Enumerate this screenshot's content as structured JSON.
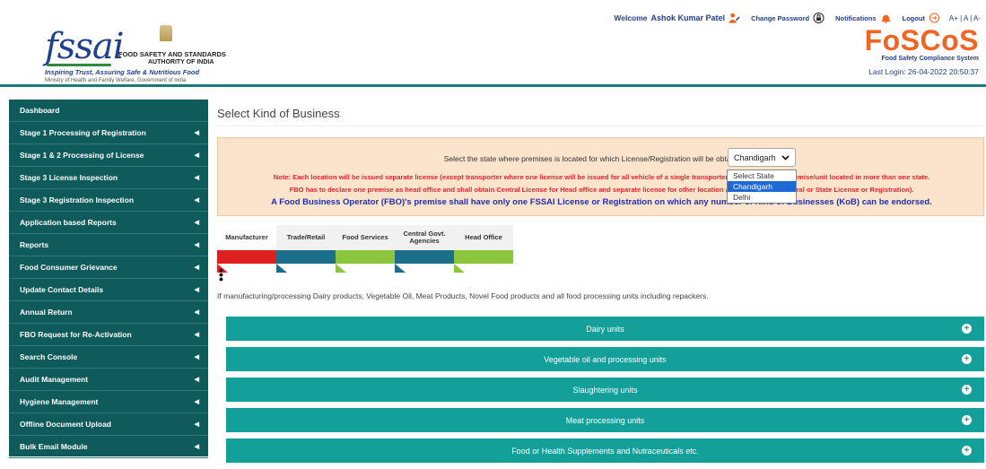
{
  "header": {
    "logo_word": "fssai",
    "org_line1": "FOOD SAFETY AND STANDARDS",
    "org_line2": "AUTHORITY OF INDIA",
    "tagline": "Inspiring Trust, Assuring Safe & Nutritious Food",
    "ministry": "Ministry of Health and Family Welfare, Government of India",
    "welcome": "Welcome",
    "user_name": "Ashok Kumar Patel",
    "change_password": "Change Password",
    "notifications": "Notifications",
    "logout": "Logout",
    "font_sizes": "A+ | A | A-",
    "brand_name": "FoSCoS",
    "brand_sub": "Food Safety Compliance System",
    "last_login": "Last Login: 26-04-2022 20:50:37"
  },
  "sidebar": {
    "items": [
      {
        "label": "Dashboard",
        "has_chevron": false
      },
      {
        "label": "Stage 1 Processing of Registration",
        "has_chevron": true
      },
      {
        "label": "Stage 1 & 2 Processing of License",
        "has_chevron": true
      },
      {
        "label": "Stage 3 License Inspection",
        "has_chevron": true
      },
      {
        "label": "Stage 3 Registration Inspection",
        "has_chevron": true
      },
      {
        "label": "Application based Reports",
        "has_chevron": true
      },
      {
        "label": "Reports",
        "has_chevron": true
      },
      {
        "label": "Food Consumer Grievance",
        "has_chevron": true
      },
      {
        "label": "Update Contact Details",
        "has_chevron": true
      },
      {
        "label": "Annual Return",
        "has_chevron": true
      },
      {
        "label": "FBO Request for Re-Activation",
        "has_chevron": true
      },
      {
        "label": "Search Console",
        "has_chevron": true
      },
      {
        "label": "Audit Management",
        "has_chevron": true
      },
      {
        "label": "Hygiene Management",
        "has_chevron": true
      },
      {
        "label": "Offline Document Upload",
        "has_chevron": true
      },
      {
        "label": "Bulk Email Module",
        "has_chevron": true
      }
    ]
  },
  "main": {
    "title": "Select Kind of Business",
    "state_prompt": "Select the state where premises is located for which License/Registration will be obtained.",
    "state_selected": "Chandigarh",
    "state_options": [
      "Select State",
      "Chandigarh",
      "Delhi"
    ],
    "note1": "Note: Each location will be issued separate license (except transporter where one license will be issued for all vehicle of a single transporter/ business having premise/unit located in more than one state.",
    "note2": "FBO has to declare one premise as head office and shall obtain Central License for Head office and separate license for other location as per eligibility (Central or State License or Registration).",
    "note3": "A Food Business Operator (FBO)'s premise shall have only one FSSAI License or Registration on which any number of Kind of Businesses (KoB) can be endorsed.",
    "tabs": [
      {
        "label": "Manufacturer",
        "color": "#e02020"
      },
      {
        "label": "Trade/Retail",
        "color": "#1c6f8a"
      },
      {
        "label": "Food Services",
        "color": "#8cc63f"
      },
      {
        "label": "Central Govt. Agencies",
        "color": "#1c6f8a"
      },
      {
        "label": "Head Office",
        "color": "#8cc63f"
      }
    ],
    "intro": "If manufacturing/processing Dairy products, Vegetable Oil, Meat Products, Novel Food products and all food processing units including repackers.",
    "accordion": [
      "Dairy units",
      "Vegetable oil and processing units",
      "Slaughtering units",
      "Meat processing units",
      "Food or Health Supplements and Nutraceuticals etc."
    ]
  }
}
